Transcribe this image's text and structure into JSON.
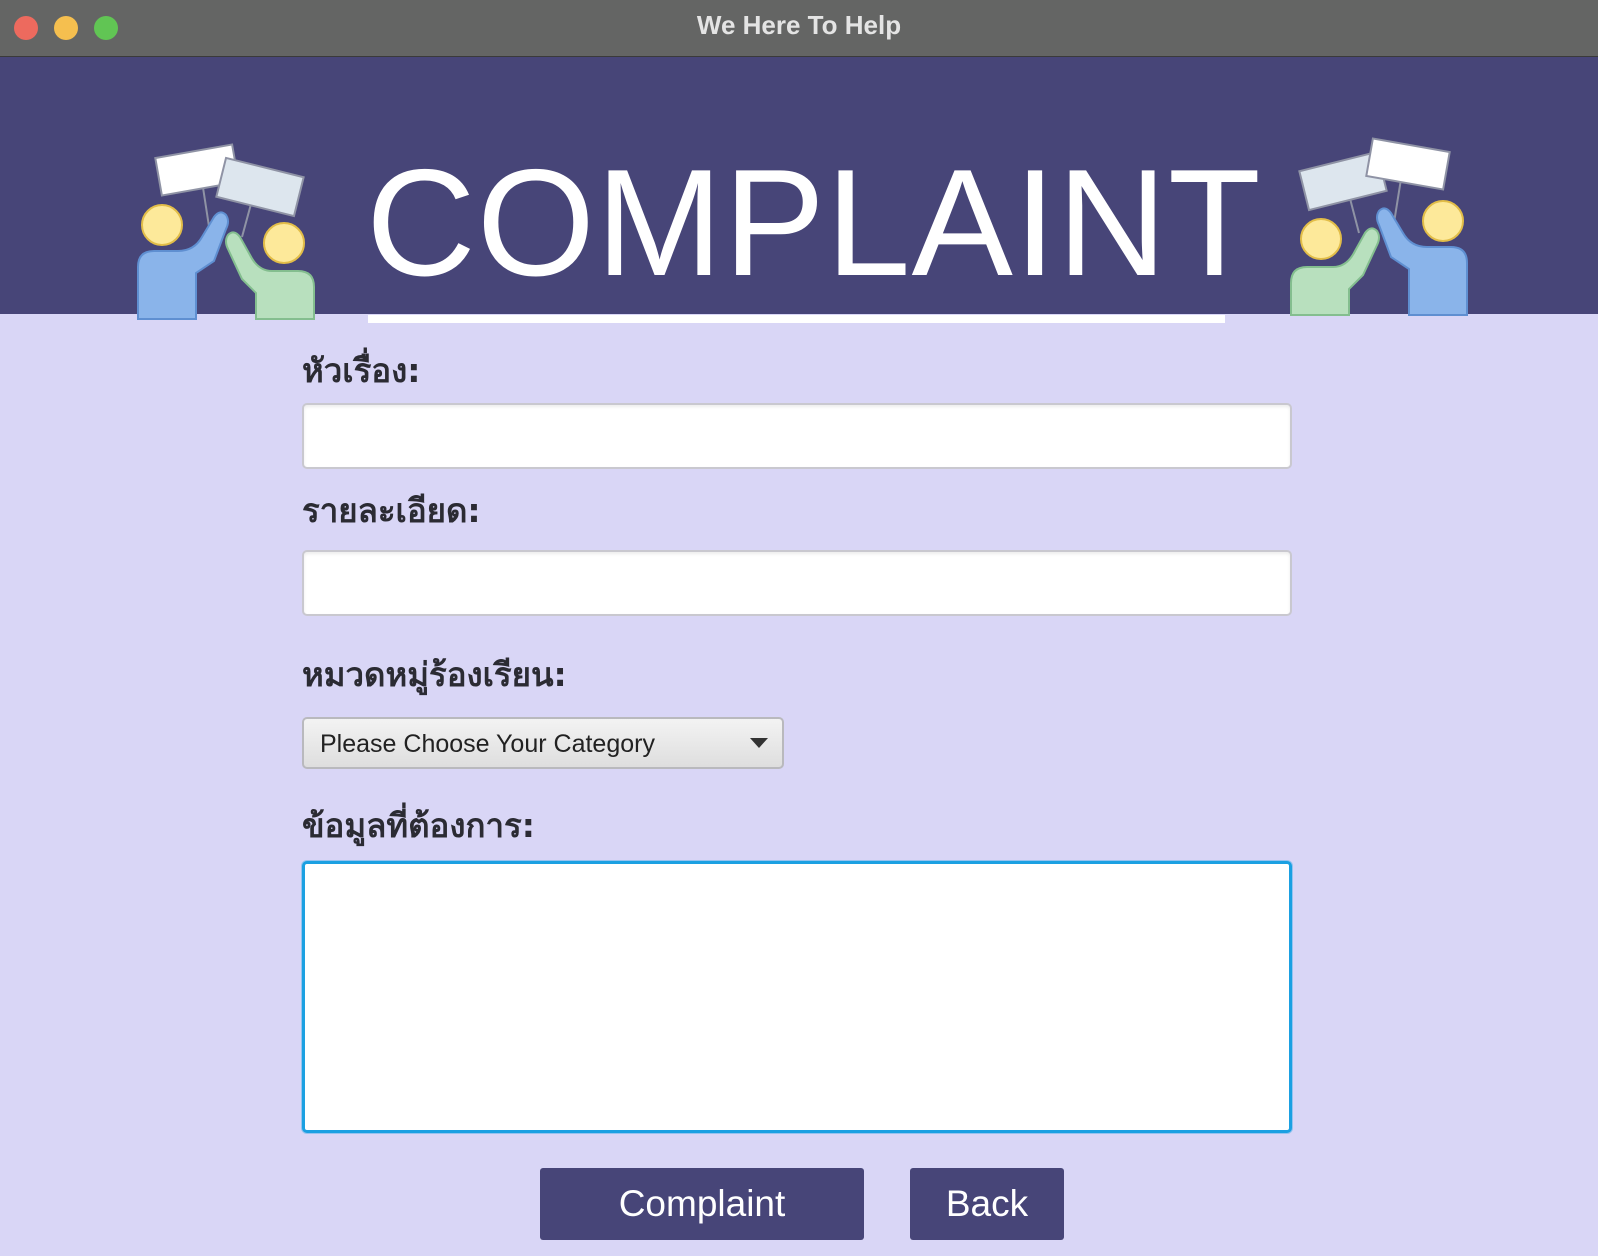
{
  "window": {
    "title": "We Here To Help"
  },
  "banner": {
    "title": "COMPLAINT",
    "background_color": "#474578",
    "left_icon": "protest-people-icon",
    "right_icon": "protest-people-icon"
  },
  "form": {
    "subject_label": "หัวเรื่อง:",
    "subject_value": "",
    "details_label": "รายละเอียด:",
    "details_value": "",
    "category_label": "หมวดหมู่ร้องเรียน:",
    "category_selected": "Please Choose Your Category",
    "request_label": "ข้อมูลที่ต้องการ:",
    "request_value": ""
  },
  "buttons": {
    "complaint_label": "Complaint",
    "back_label": "Back"
  },
  "colors": {
    "accent": "#474578",
    "page_background": "#d9d6f6",
    "focus_border": "#1ba0e2"
  }
}
